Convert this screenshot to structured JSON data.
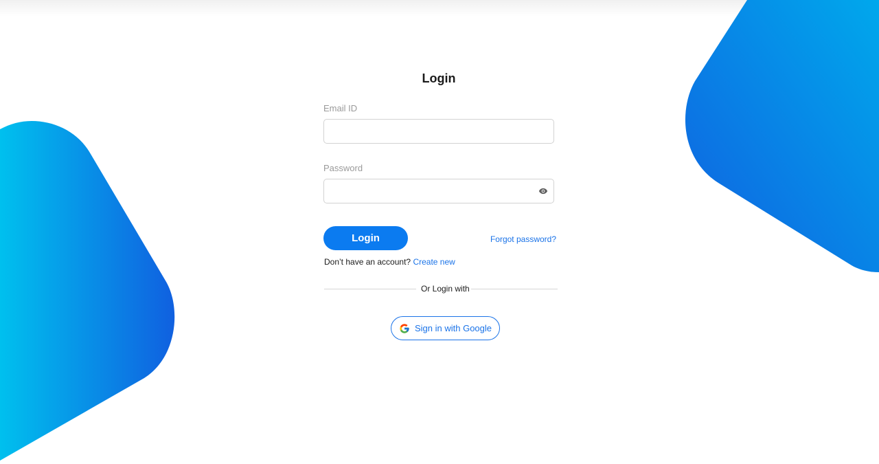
{
  "login": {
    "title": "Login",
    "email_label": "Email ID",
    "email_value": "",
    "password_label": "Password",
    "password_value": "",
    "login_button": "Login",
    "forgot_password": "Forgot password?",
    "no_account_text": "Don’t have an account?",
    "create_new": "Create new",
    "or_login_with": "Or Login with",
    "google_button": "Sign in with Google"
  },
  "icons": {
    "password_toggle": "eye-icon",
    "google": "google-icon"
  },
  "colors": {
    "accent": "#0b7bf0",
    "link": "#1a73e8",
    "shape_gradient_start": "#00c0ee",
    "shape_gradient_end": "#1060e0"
  }
}
